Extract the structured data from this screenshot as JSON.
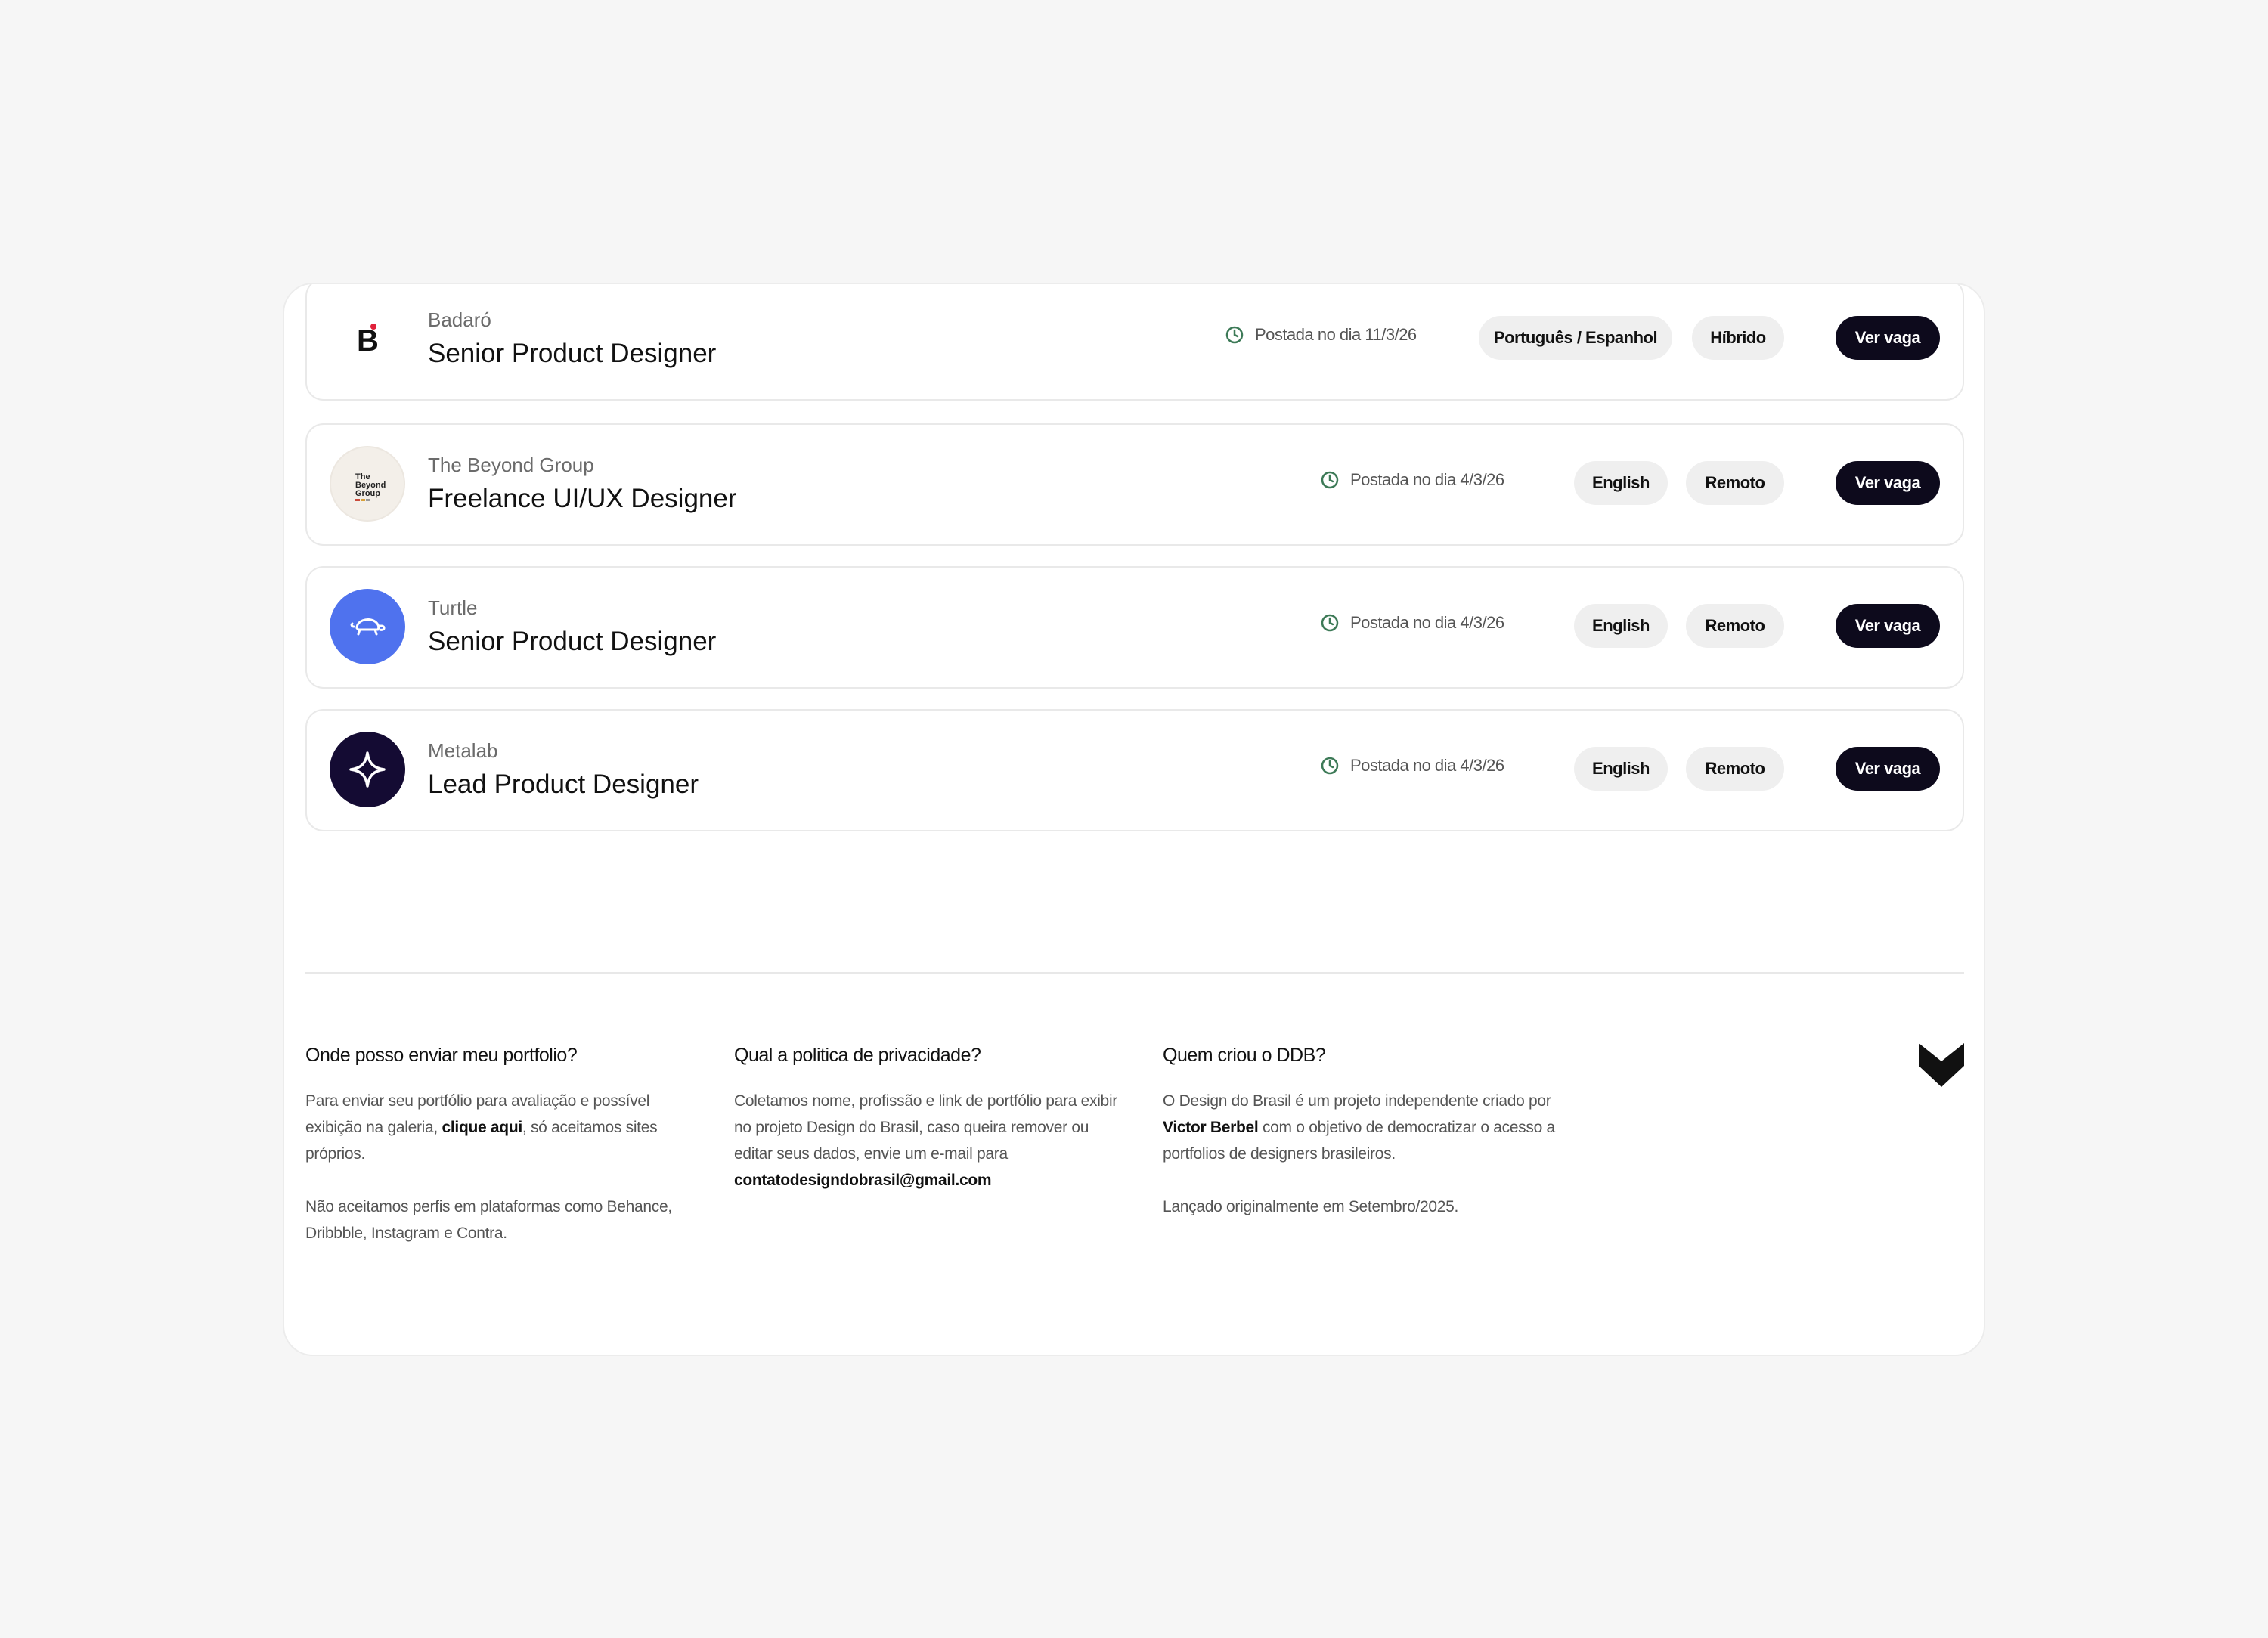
{
  "jobs": [
    {
      "company": "Badaró",
      "title": "Senior Product Designer",
      "posted": "Postada no dia 11/3/26",
      "language": "Português / Espanhol",
      "mode": "Híbrido",
      "cta": "Ver vaga",
      "logo": "badaro-logo"
    },
    {
      "company": "The Beyond Group",
      "title": "Freelance UI/UX Designer",
      "posted": "Postada no dia 4/3/26",
      "language": "English",
      "mode": "Remoto",
      "cta": "Ver vaga",
      "logo": "beyond-group-logo",
      "logo_text": [
        "The",
        "Beyond",
        "Group"
      ]
    },
    {
      "company": "Turtle",
      "title": "Senior Product Designer",
      "posted": "Postada no dia 4/3/26",
      "language": "English",
      "mode": "Remoto",
      "cta": "Ver vaga",
      "logo": "turtle-logo"
    },
    {
      "company": "Metalab",
      "title": "Lead Product Designer",
      "posted": "Postada no dia 4/3/26",
      "language": "English",
      "mode": "Remoto",
      "cta": "Ver vaga",
      "logo": "metalab-logo"
    }
  ],
  "footer": {
    "col1": {
      "heading": "Onde posso enviar meu portfolio?",
      "p1_before": "Para enviar seu portfólio para avaliação e possível exibição na galeria, ",
      "p1_link": "clique aqui",
      "p1_after": ", só aceitamos sites próprios.",
      "p2": "Não aceitamos perfis em plataformas como Behance, Dribbble, Instagram e Contra."
    },
    "col2": {
      "heading": "Qual a politica de privacidade?",
      "p1": "Coletamos nome, profissão e link de portfólio para exibir no projeto Design do Brasil, caso queira remover ou editar seus dados, envie um e-mail para ",
      "email": "contatodesigndobrasil@gmail.com"
    },
    "col3": {
      "heading": "Quem criou o DDB?",
      "p1_before": "O Design do Brasil é um projeto independente criado por ",
      "p1_author": "Victor Berbel",
      "p1_after": " com o objetivo de democratizar o acesso a portfolios de designers brasileiros.",
      "p2": "Lançado originalmente em Setembro/2025."
    },
    "brand_icon": "ddb-logo-icon"
  },
  "colors": {
    "background": "#f6f6f6",
    "button": "#0d0a1c",
    "pill": "#efefef",
    "clock": "#3d7a57",
    "turtle": "#4f72ee",
    "metalab": "#140b33"
  }
}
